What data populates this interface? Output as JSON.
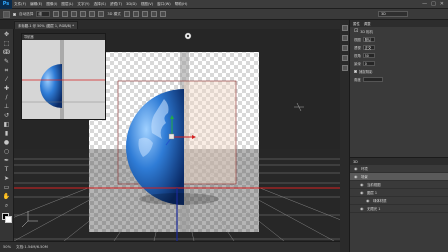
{
  "app": {
    "logo": "Ps"
  },
  "menu": [
    "文件(F)",
    "编辑(E)",
    "图像(I)",
    "图层(L)",
    "文字(Y)",
    "选择(S)",
    "滤镜(T)",
    "3D(D)",
    "视图(V)",
    "窗口(W)",
    "帮助(H)"
  ],
  "window_controls": [
    "—",
    "□",
    "✕"
  ],
  "options_bar": {
    "auto_select": "自动选择",
    "layer_select": "组",
    "show_transform": "3D 模式",
    "workspace": "3D"
  },
  "doc_tabs": [
    {
      "label": "未标题-1 @ 50% (图层 1, RGB/8) *",
      "active": true
    }
  ],
  "status_bar": {
    "zoom": "50%",
    "doc_info": "文档:1.54M/6.50M"
  },
  "navigator": {
    "title": "导航器"
  },
  "properties": {
    "tabs": [
      "属性",
      "调整"
    ],
    "section_label": "3D 相机",
    "rows": [
      {
        "label": "视图",
        "value": "默认"
      },
      {
        "label": "透视",
        "value": "正交"
      },
      {
        "label": "视角",
        "value": "50"
      },
      {
        "label": "景深",
        "value": "0"
      }
    ],
    "checkbox_label": "捕捉阴影",
    "extra_label": "角度"
  },
  "layers": {
    "title": "3D",
    "items": [
      {
        "name": "环境",
        "active": false
      },
      {
        "name": "场景",
        "active": true
      },
      {
        "name": "当前视图",
        "active": false
      },
      {
        "name": "图层 1",
        "active": false
      },
      {
        "name": "球体材质",
        "active": false
      },
      {
        "name": "无限光 1",
        "active": false
      }
    ]
  },
  "colors": {
    "accent": "#31a8ff",
    "panel": "#3a3a3a",
    "red_axis": "#d42020",
    "blue_axis": "#1a2a9a",
    "green_axis": "#22aa44"
  }
}
